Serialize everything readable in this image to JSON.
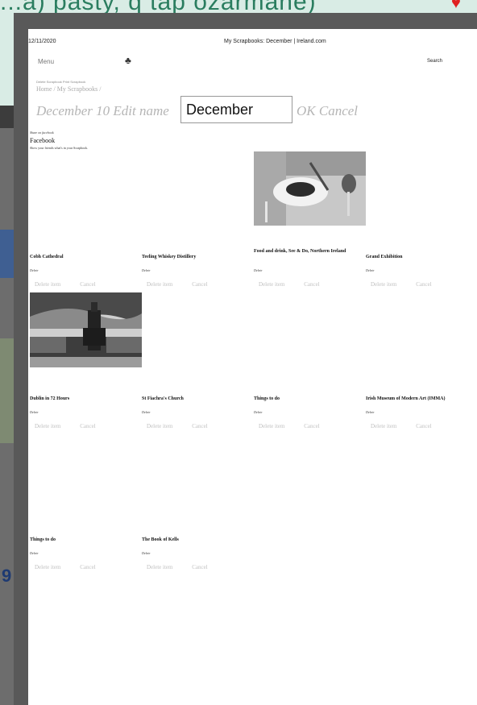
{
  "background": {
    "headline": "...a) pasty, q tap ozarmane)"
  },
  "header": {
    "date": "12/11/2020",
    "page_title": "My Scrapbooks: December | Ireland.com",
    "menu": "Menu",
    "search": "Search"
  },
  "toolbar": {
    "small_links": "Delete Scrapbook  Print Scrapbook",
    "breadcrumb": "Home  /  My Scrapbooks  /"
  },
  "title_row": {
    "title": "December 10",
    "edit_name": "Edit name",
    "input_value": "December",
    "ok": "OK",
    "cancel": "Cancel"
  },
  "share": {
    "heading": "Share on facebook",
    "link": "Facebook",
    "subtitle": "Show your friends what's in your Scrapbook."
  },
  "item_actions": {
    "delete_link": "Delete",
    "delete_item": "Delete item",
    "cancel": "Cancel"
  },
  "items": [
    {
      "title": "Cobh Cathedral"
    },
    {
      "title": "Teeling Whiskey Distillery"
    },
    {
      "title": "Food and drink, See & Do, Northern Ireland"
    },
    {
      "title": "Grand Exhibition"
    },
    {
      "title": "Dublin in 72 Hours"
    },
    {
      "title": "St Fiachra's Church"
    },
    {
      "title": "Things to do"
    },
    {
      "title": "Irish Museum of Modern Art (IMMA)"
    },
    {
      "title": "Things to do"
    },
    {
      "title": "The Book of Kells"
    }
  ]
}
